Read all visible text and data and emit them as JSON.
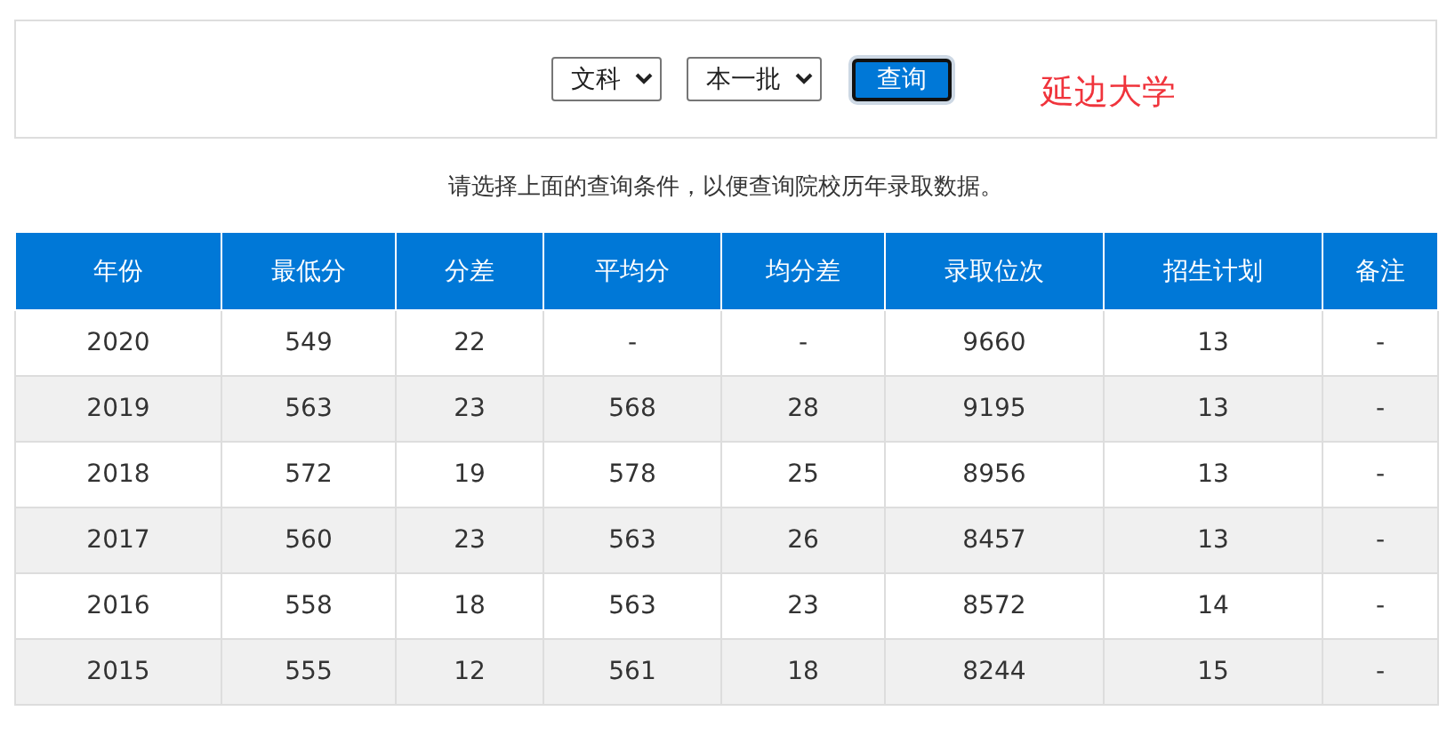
{
  "filters": [
    {
      "value": "文科"
    },
    {
      "value": "本一批"
    }
  ],
  "query_button": {
    "label": "查询"
  },
  "school_name": "延边大学",
  "hint": "请选择上面的查询条件，以便查询院校历年录取数据。",
  "table": {
    "columns": [
      "年份",
      "最低分",
      "分差",
      "平均分",
      "均分差",
      "录取位次",
      "招生计划",
      "备注"
    ],
    "rows": [
      [
        "2020",
        "549",
        "22",
        "-",
        "-",
        "9660",
        "13",
        "-"
      ],
      [
        "2019",
        "563",
        "23",
        "568",
        "28",
        "9195",
        "13",
        "-"
      ],
      [
        "2018",
        "572",
        "19",
        "578",
        "25",
        "8956",
        "13",
        "-"
      ],
      [
        "2017",
        "560",
        "23",
        "563",
        "26",
        "8457",
        "13",
        "-"
      ],
      [
        "2016",
        "558",
        "18",
        "563",
        "23",
        "8572",
        "14",
        "-"
      ],
      [
        "2015",
        "555",
        "12",
        "561",
        "18",
        "8244",
        "15",
        "-"
      ]
    ]
  }
}
